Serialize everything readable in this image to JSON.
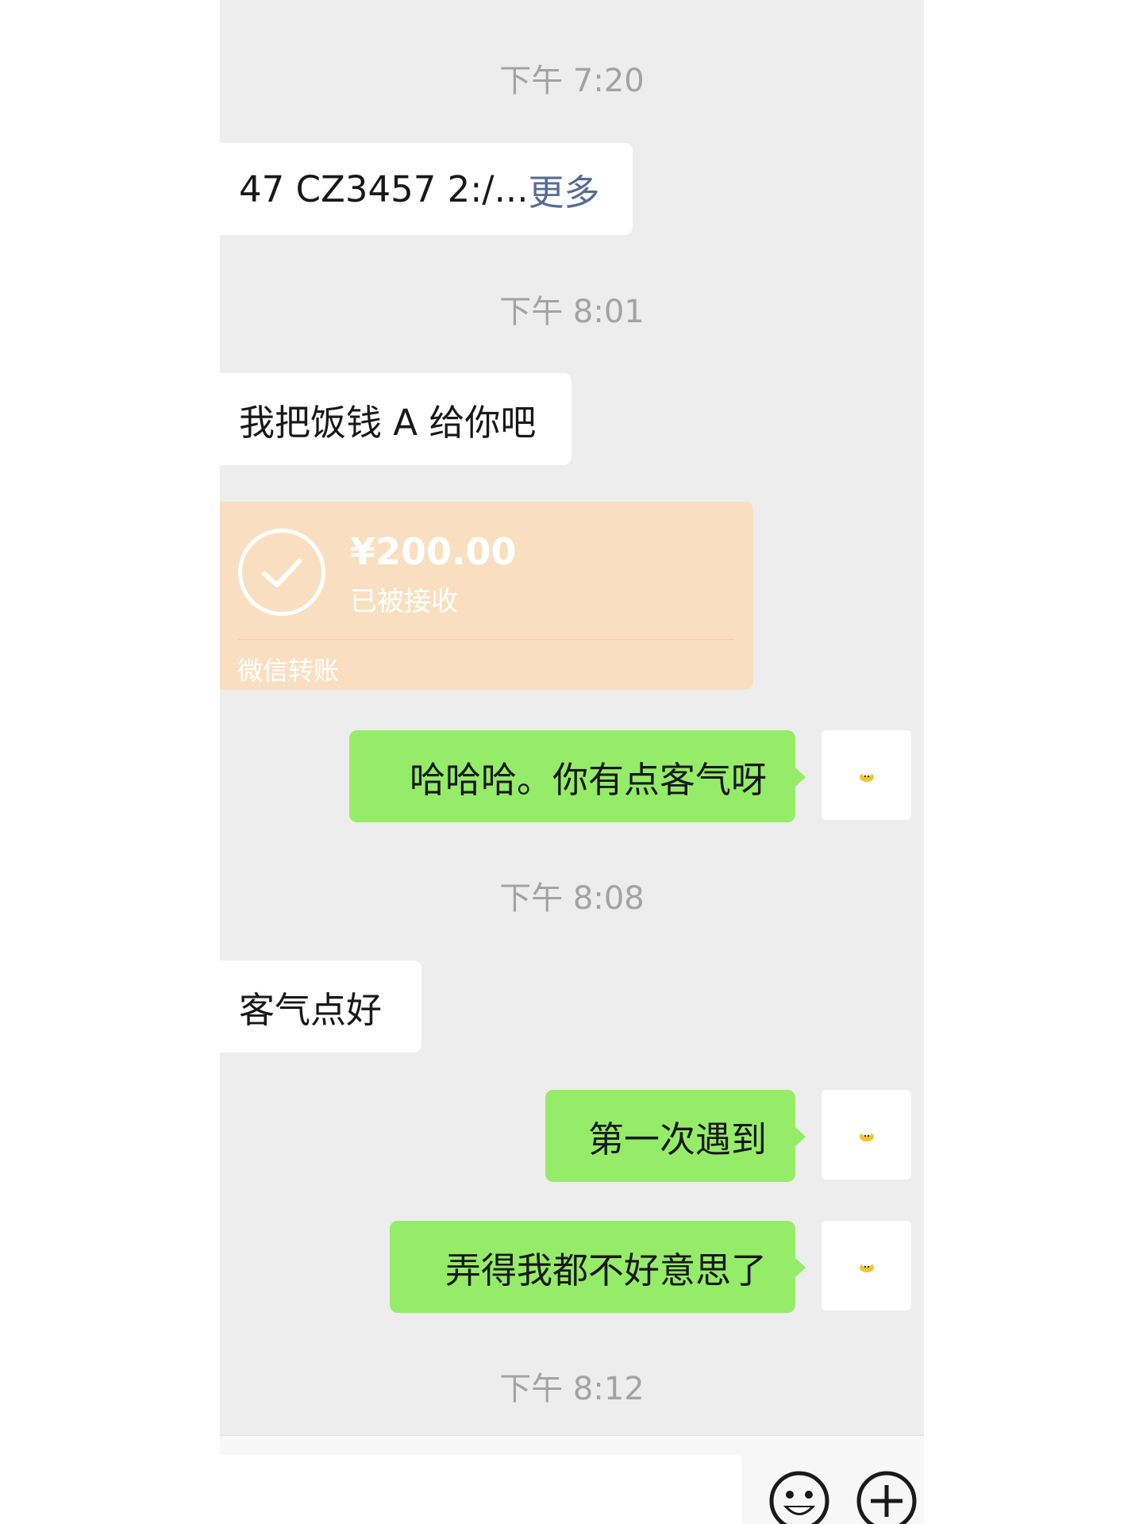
{
  "chat": {
    "timestamps": [
      "下午 7:20",
      "下午 8:01",
      "下午 8:08",
      "下午 8:12"
    ],
    "messages": {
      "m1_text": "47 CZ3457  2:/...",
      "m1_more": "更多",
      "m2": "我把饭钱 A 给你吧",
      "m3": "哈哈哈。你有点客气呀",
      "m4": "客气点好",
      "m5": "第一次遇到",
      "m6": "弄得我都不好意思了"
    },
    "transfer": {
      "amount": "¥200.00",
      "status": "已被接收",
      "label": "微信转账"
    }
  },
  "icons": {
    "avatar": "duck-avatar-icon",
    "check": "check-circle-icon",
    "emoji": "emoji-icon",
    "more": "plus-circle-icon"
  },
  "colors": {
    "background": "#ededed",
    "incoming_bubble": "#ffffff",
    "outgoing_bubble": "#95ec69",
    "transfer_card": "#f9dfc0",
    "link": "#576b95"
  }
}
